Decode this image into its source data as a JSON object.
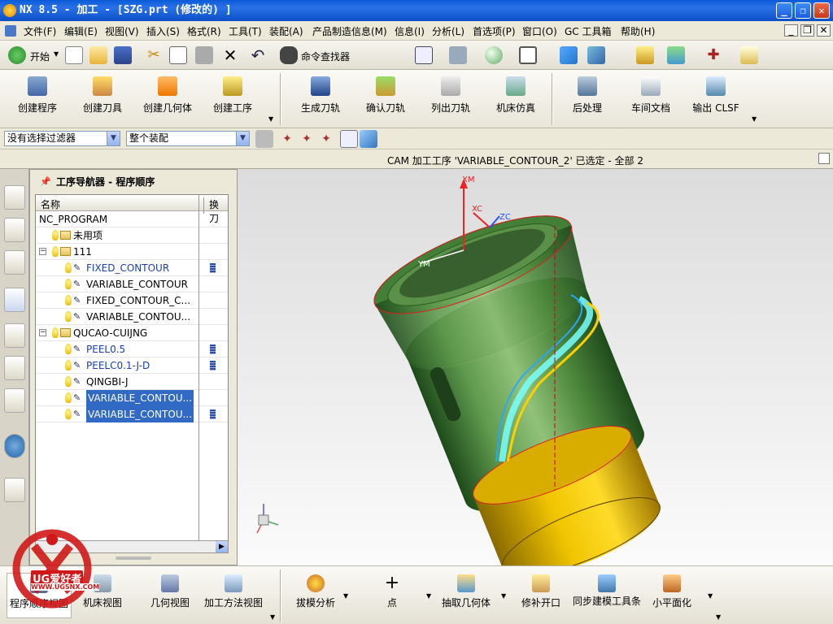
{
  "title": "NX 8.5 - 加工 - [SZG.prt  (修改的) ]",
  "menu": [
    "文件(F)",
    "编辑(E)",
    "视图(V)",
    "插入(S)",
    "格式(R)",
    "工具(T)",
    "装配(A)",
    "产品制造信息(M)",
    "信息(I)",
    "分析(L)",
    "首选项(P)",
    "窗口(O)",
    "GC 工具箱",
    "帮助(H)"
  ],
  "toolbar1": {
    "start_label": "开始",
    "command_finder": "命令查找器"
  },
  "toolbar2": [
    {
      "label": "创建程序",
      "icon": "create-program-icon"
    },
    {
      "label": "创建刀具",
      "icon": "create-tool-icon"
    },
    {
      "label": "创建几何体",
      "icon": "create-geometry-icon"
    },
    {
      "label": "创建工序",
      "icon": "create-operation-icon"
    },
    {
      "label": "生成刀轨",
      "icon": "generate-toolpath-icon"
    },
    {
      "label": "确认刀轨",
      "icon": "verify-toolpath-icon"
    },
    {
      "label": "列出刀轨",
      "icon": "list-toolpath-icon"
    },
    {
      "label": "机床仿真",
      "icon": "machine-simulation-icon"
    },
    {
      "label": "后处理",
      "icon": "postprocess-icon"
    },
    {
      "label": "车间文档",
      "icon": "shop-doc-icon"
    },
    {
      "label": "输出 CLSF",
      "icon": "output-clsf-icon"
    }
  ],
  "filter": {
    "selection_filter": "没有选择过滤器",
    "assembly_scope": "整个装配"
  },
  "status_text": "CAM 加工工序 'VARIABLE_CONTOUR_2' 已选定 - 全部 2",
  "navigator": {
    "title": "工序导航器 - 程序顺序",
    "col_name": "名称",
    "col_tool_change": "换刀",
    "rows": [
      {
        "name": "NC_PROGRAM",
        "indent": 0,
        "kind": "root",
        "change": false,
        "selected": false
      },
      {
        "name": "未用项",
        "indent": 1,
        "kind": "folder",
        "change": false,
        "selected": false
      },
      {
        "name": "111",
        "indent": 1,
        "kind": "group",
        "change": false,
        "selected": false
      },
      {
        "name": "FIXED_CONTOUR",
        "indent": 2,
        "kind": "op",
        "change": true,
        "selected": false,
        "blue": true
      },
      {
        "name": "VARIABLE_CONTOUR",
        "indent": 2,
        "kind": "op",
        "change": false,
        "selected": false,
        "blue": false
      },
      {
        "name": "FIXED_CONTOUR_C...",
        "indent": 2,
        "kind": "op",
        "change": false,
        "selected": false,
        "blue": false
      },
      {
        "name": "VARIABLE_CONTOU...",
        "indent": 2,
        "kind": "op",
        "change": false,
        "selected": false,
        "blue": false
      },
      {
        "name": "QUCAO-CUIJNG",
        "indent": 1,
        "kind": "group",
        "change": false,
        "selected": false
      },
      {
        "name": "PEEL0.5",
        "indent": 2,
        "kind": "op",
        "change": true,
        "selected": false,
        "blue": true
      },
      {
        "name": "PEELC0.1-J-D",
        "indent": 2,
        "kind": "op",
        "change": true,
        "selected": false,
        "blue": true
      },
      {
        "name": "QINGBI-J",
        "indent": 2,
        "kind": "op",
        "change": false,
        "selected": false,
        "blue": false
      },
      {
        "name": "VARIABLE_CONTOU...",
        "indent": 2,
        "kind": "op",
        "change": false,
        "selected": true,
        "blue": false
      },
      {
        "name": "VARIABLE_CONTOU...",
        "indent": 2,
        "kind": "op",
        "change": true,
        "selected": true,
        "blue": false
      }
    ]
  },
  "viewport": {
    "label_xm": "XM",
    "label_xc": "XC",
    "label_ym": "YM",
    "label_zc": "ZC"
  },
  "bottom_left": [
    "程序顺序视图",
    "机床视图",
    "几何视图",
    "加工方法视图"
  ],
  "bottom_right": [
    "拔模分析",
    "点",
    "抽取几何体",
    "修补开口",
    "同步建模工具条",
    "小平面化"
  ],
  "watermark": {
    "brand": "UG爱好者",
    "url": "WWW.UGSNX.COM"
  }
}
